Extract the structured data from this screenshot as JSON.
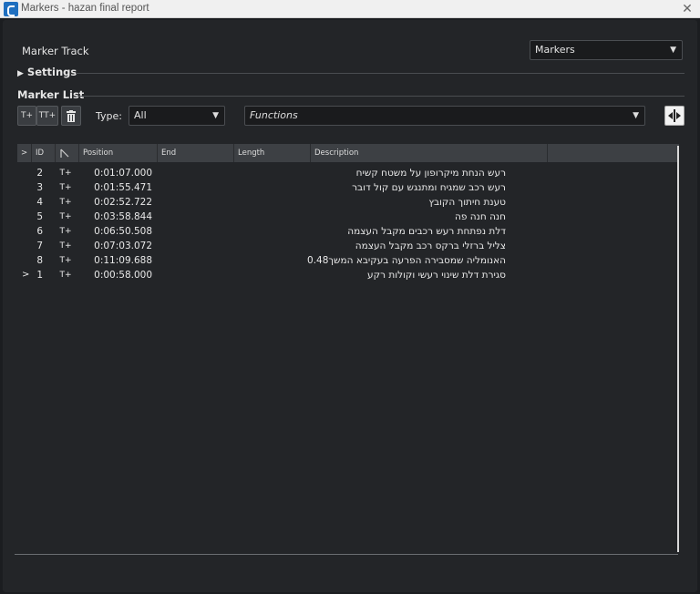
{
  "window": {
    "title": "Markers - hazan final report",
    "close_glyph": "✕",
    "app_icon": "cubase-logo-icon"
  },
  "track": {
    "label": "Marker Track",
    "selected": "Markers"
  },
  "settings": {
    "label": "Settings"
  },
  "marker_list": {
    "label": "Marker List",
    "add_marker_label": "T+",
    "add_cycle_marker_label": "TT+",
    "delete_icon": "trash-icon",
    "type_label": "Type:",
    "type_value": "All",
    "functions_value": "Functions",
    "right_button_icon": "locate-icon"
  },
  "table": {
    "columns": [
      ">",
      "ID",
      "",
      "Position",
      "End",
      "Length",
      "Description"
    ],
    "rows": [
      {
        "active": "",
        "id": "2",
        "type": "T+",
        "position": "0:01:07.000",
        "description": "רעש הנחת מיקרופון על משטח קשיח"
      },
      {
        "active": "",
        "id": "3",
        "type": "T+",
        "position": "0:01:55.471",
        "description": "רעש רכב שמגיח ומתנגש עם קול דובר"
      },
      {
        "active": "",
        "id": "4",
        "type": "T+",
        "position": "0:02:52.722",
        "description": "טענת חיתוך הקובץ"
      },
      {
        "active": "",
        "id": "5",
        "type": "T+",
        "position": "0:03:58.844",
        "description": "חנה חנה פה"
      },
      {
        "active": "",
        "id": "6",
        "type": "T+",
        "position": "0:06:50.508",
        "description": "דלת נפתחת רעש רכבים מקבל העצמה"
      },
      {
        "active": "",
        "id": "7",
        "type": "T+",
        "position": "0:07:03.072",
        "description": "צליל ברזלי ברקס רכב מקבל העצמה"
      },
      {
        "active": "",
        "id": "8",
        "type": "T+",
        "position": "0:11:09.688",
        "description": "האנומליה שמסבירה הפרעה בעקיבא המשך0.48"
      },
      {
        "active": ">",
        "id": "1",
        "type": "T+",
        "position": "0:00:58.000",
        "description": "סגירת דלת שינוי רעשי וקולות רקע"
      }
    ]
  }
}
